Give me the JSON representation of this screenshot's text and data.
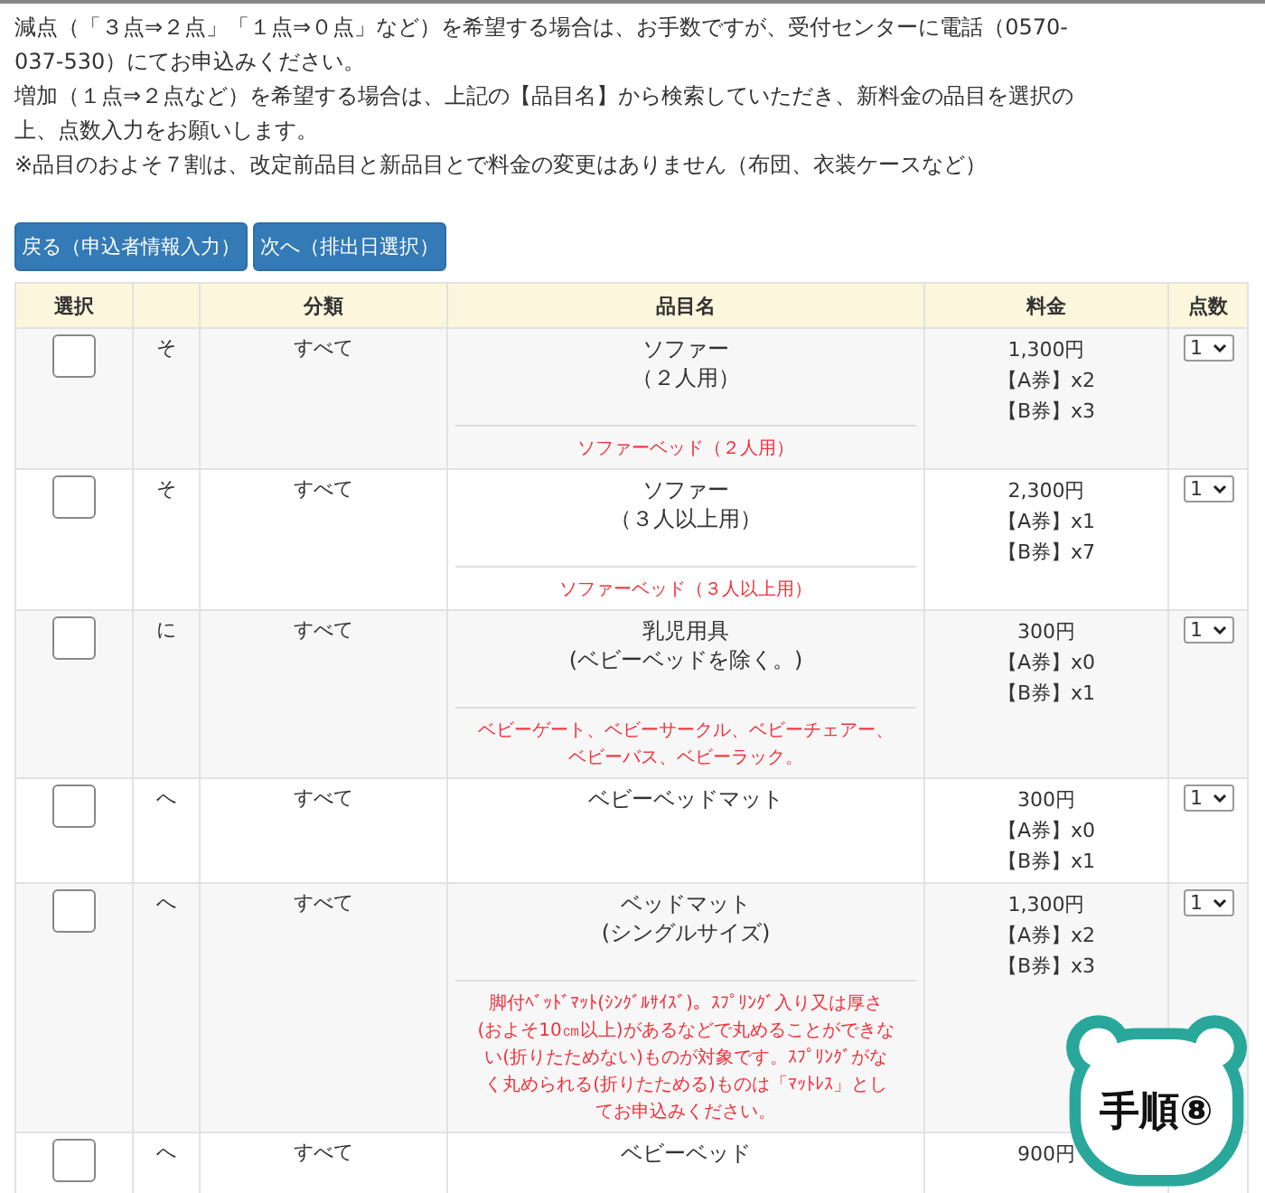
{
  "notes": [
    "減点（「３点⇒２点」「１点⇒０点」など）を希望する場合は、お手数ですが、受付センターに電話（0570-037-530）にてお申込みください。",
    "増加（１点⇒２点など）を希望する場合は、上記の【品目名】から検索していただき、新料金の品目を選択の上、点数入力をお願いします。",
    "※品目のおよそ７割は、改定前品目と新品目とで料金の変更はありません（布団、衣装ケースなど）"
  ],
  "buttons": [
    {
      "label": "戻る（申込者情報入力）"
    },
    {
      "label": "次へ（排出日選択）"
    }
  ],
  "table": {
    "headers": {
      "select": "選択",
      "category": "分類",
      "item": "品目名",
      "price": "料金",
      "qty": "点数"
    },
    "rows": [
      {
        "checked": false,
        "kana": "そ",
        "category": "すべて",
        "name": [
          "ソファー",
          "（２人用）"
        ],
        "note": "ソファーベッド（２人用）",
        "price": "1,300円",
        "tickets": [
          "【A券】x2",
          "【B券】x3"
        ],
        "qty": "1"
      },
      {
        "checked": false,
        "kana": "そ",
        "category": "すべて",
        "name": [
          "ソファー",
          "（３人以上用）"
        ],
        "note": "ソファーベッド（３人以上用）",
        "price": "2,300円",
        "tickets": [
          "【A券】x1",
          "【B券】x7"
        ],
        "qty": "1"
      },
      {
        "checked": false,
        "kana": "に",
        "category": "すべて",
        "name": [
          "乳児用具",
          "(ベビーベッドを除く。)"
        ],
        "note": "ベビーゲート、ベビーサークル、ベビーチェアー、ベビーバス、ベビーラック。",
        "price": "300円",
        "tickets": [
          "【A券】x0",
          "【B券】x1"
        ],
        "qty": "1"
      },
      {
        "checked": false,
        "kana": "へ",
        "category": "すべて",
        "name": [
          "ベビーベッドマット"
        ],
        "price": "300円",
        "tickets": [
          "【A券】x0",
          "【B券】x1"
        ],
        "qty": "1"
      },
      {
        "checked": false,
        "kana": "へ",
        "category": "すべて",
        "name": [
          "ベッドマット",
          "(シングルサイズ)"
        ],
        "note": "脚付ﾍﾞｯﾄﾞﾏｯﾄ(ｼﾝｸﾞﾙｻｲｽﾞ)。ｽﾌﾟﾘﾝｸﾞ入り又は厚さ(およそ10㎝以上)があるなどで丸めることができない(折りたためない)ものが対象です。ｽﾌﾟﾘﾝｸﾞがなく丸められる(折りたためる)ものは「ﾏｯﾄﾚｽ」としてお申込みください。",
        "price": "1,300円",
        "tickets": [
          "【A券】x2",
          "【B券】x3"
        ],
        "qty": "1"
      },
      {
        "checked": false,
        "kana": "へ",
        "category": "すべて",
        "name": [
          "ベビーベッド"
        ],
        "price": "900円"
      }
    ]
  },
  "badge": {
    "text": "手順⑧"
  }
}
